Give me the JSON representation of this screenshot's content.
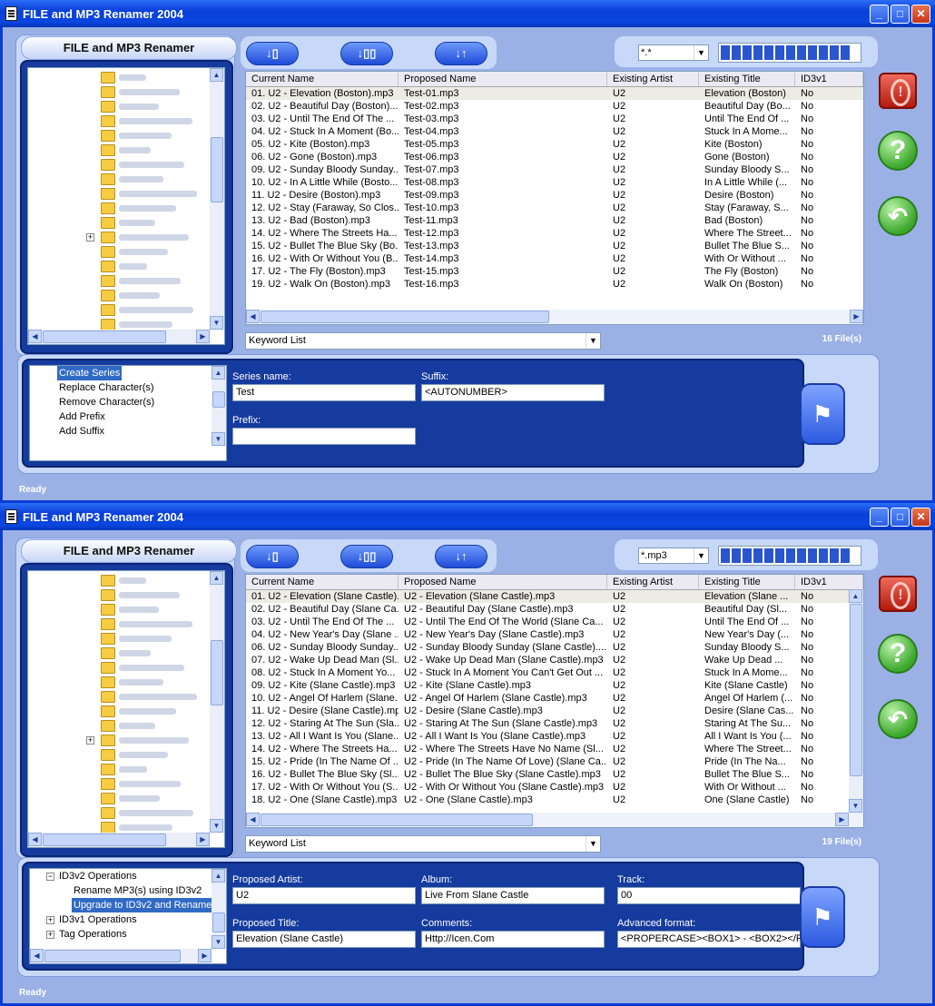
{
  "windows": [
    {
      "title": "FILE and MP3 Renamer 2004",
      "panel_title": "FILE and MP3 Renamer",
      "filter_value": "*.*",
      "files_count": "16 File(s)",
      "keyword_list": "Keyword List",
      "status": "Ready",
      "columns": [
        "Current Name",
        "Proposed Name",
        "Existing Artist",
        "Existing Title",
        "ID3v1"
      ],
      "rows": [
        [
          "01. U2 - Elevation (Boston).mp3",
          "Test-01.mp3",
          "U2",
          "Elevation (Boston)",
          "No"
        ],
        [
          "02. U2 - Beautiful Day (Boston)....",
          "Test-02.mp3",
          "U2",
          "Beautiful Day (Bo...",
          "No"
        ],
        [
          "03. U2 - Until The End Of The ...",
          "Test-03.mp3",
          "U2",
          "Until The End Of ...",
          "No"
        ],
        [
          "04. U2 - Stuck In A Moment (Bo...",
          "Test-04.mp3",
          "U2",
          "Stuck In A Mome...",
          "No"
        ],
        [
          "05. U2 - Kite (Boston).mp3",
          "Test-05.mp3",
          "U2",
          "Kite (Boston)",
          "No"
        ],
        [
          "06. U2 - Gone (Boston).mp3",
          "Test-06.mp3",
          "U2",
          "Gone (Boston)",
          "No"
        ],
        [
          "09. U2 - Sunday Bloody Sunday...",
          "Test-07.mp3",
          "U2",
          "Sunday Bloody S...",
          "No"
        ],
        [
          "10. U2 - In A Little While (Bosto...",
          "Test-08.mp3",
          "U2",
          "In A Little While (...",
          "No"
        ],
        [
          "11. U2 - Desire (Boston).mp3",
          "Test-09.mp3",
          "U2",
          "Desire (Boston)",
          "No"
        ],
        [
          "12. U2 - Stay (Faraway, So Clos...",
          "Test-10.mp3",
          "U2",
          "Stay (Faraway, S...",
          "No"
        ],
        [
          "13. U2 - Bad (Boston).mp3",
          "Test-11.mp3",
          "U2",
          "Bad (Boston)",
          "No"
        ],
        [
          "14. U2 - Where The Streets Ha...",
          "Test-12.mp3",
          "U2",
          "Where The Street...",
          "No"
        ],
        [
          "15. U2 - Bullet The Blue Sky (Bo...",
          "Test-13.mp3",
          "U2",
          "Bullet The Blue S...",
          "No"
        ],
        [
          "16. U2 - With Or Without You (B...",
          "Test-14.mp3",
          "U2",
          "With Or Without ...",
          "No"
        ],
        [
          "17. U2 - The Fly (Boston).mp3",
          "Test-15.mp3",
          "U2",
          "The Fly (Boston)",
          "No"
        ],
        [
          "19. U2 - Walk On (Boston).mp3",
          "Test-16.mp3",
          "U2",
          "Walk On (Boston)",
          "No"
        ]
      ],
      "ops_items": [
        "Create Series",
        "Replace Character(s)",
        "Remove Character(s)",
        "Add Prefix",
        "Add Suffix"
      ],
      "fields": {
        "series_name_label": "Series name:",
        "series_name_value": "Test",
        "suffix_label": "Suffix:",
        "suffix_value": "<AUTONUMBER>",
        "prefix_label": "Prefix:",
        "prefix_value": ""
      }
    },
    {
      "title": "FILE and MP3 Renamer 2004",
      "panel_title": "FILE and MP3 Renamer",
      "filter_value": "*.mp3",
      "files_count": "19 File(s)",
      "keyword_list": "Keyword List",
      "status": "Ready",
      "columns": [
        "Current Name",
        "Proposed Name",
        "Existing Artist",
        "Existing Title",
        "ID3v1"
      ],
      "rows": [
        [
          "01. U2 - Elevation (Slane Castle)...",
          "U2 - Elevation (Slane Castle).mp3",
          "U2",
          "Elevation (Slane ...",
          "No"
        ],
        [
          "02. U2 - Beautiful Day (Slane Ca...",
          "U2 - Beautiful Day (Slane Castle).mp3",
          "U2",
          "Beautiful Day (Sl...",
          "No"
        ],
        [
          "03. U2 - Until The End Of The ...",
          "U2 - Until The End Of The World (Slane Ca...",
          "U2",
          "Until The End Of ...",
          "No"
        ],
        [
          "04. U2 - New Year's Day (Slane ...",
          "U2 - New Year's Day (Slane Castle).mp3",
          "U2",
          "New Year's Day (...",
          "No"
        ],
        [
          "06. U2 - Sunday Bloody Sunday...",
          "U2 - Sunday Bloody Sunday (Slane Castle)....",
          "U2",
          "Sunday Bloody S...",
          "No"
        ],
        [
          "07. U2 - Wake Up Dead Man (Sl...",
          "U2 - Wake Up Dead Man (Slane Castle).mp3",
          "U2",
          "Wake Up Dead ...",
          "No"
        ],
        [
          "08. U2 - Stuck In A Moment Yo...",
          "U2 - Stuck In A Moment You Can't Get Out ...",
          "U2",
          "Stuck In A Mome...",
          "No"
        ],
        [
          "09. U2 - Kite (Slane Castle).mp3",
          "U2 - Kite (Slane Castle).mp3",
          "U2",
          "Kite (Slane Castle)",
          "No"
        ],
        [
          "10. U2 - Angel Of Harlem (Slane...",
          "U2 - Angel Of Harlem (Slane Castle).mp3",
          "U2",
          "Angel Of Harlem (...",
          "No"
        ],
        [
          "11. U2 - Desire (Slane Castle).mp3",
          "U2 - Desire (Slane Castle).mp3",
          "U2",
          "Desire (Slane Cas...",
          "No"
        ],
        [
          "12. U2 - Staring At The Sun (Sla...",
          "U2 - Staring At The Sun (Slane Castle).mp3",
          "U2",
          "Staring At The Su...",
          "No"
        ],
        [
          "13. U2 - All I Want Is You (Slane...",
          "U2 - All I Want Is You (Slane Castle).mp3",
          "U2",
          "All I Want Is You (...",
          "No"
        ],
        [
          "14. U2 - Where The Streets Ha...",
          "U2 - Where The Streets Have No Name (Sl...",
          "U2",
          "Where The Street...",
          "No"
        ],
        [
          "15. U2 - Pride (In The Name Of ...",
          "U2 - Pride (In The Name Of Love) (Slane Ca...",
          "U2",
          "Pride (In The Na...",
          "No"
        ],
        [
          "16. U2 - Bullet The Blue Sky (Sl...",
          "U2 - Bullet The Blue Sky (Slane Castle).mp3",
          "U2",
          "Bullet The Blue S...",
          "No"
        ],
        [
          "17. U2 - With Or Without You (S...",
          "U2 - With Or Without You (Slane Castle).mp3",
          "U2",
          "With Or Without ...",
          "No"
        ],
        [
          "18. U2 - One (Slane Castle).mp3",
          "U2 - One (Slane Castle).mp3",
          "U2",
          "One (Slane Castle)",
          "No"
        ]
      ],
      "ops_items": [
        "ID3v2 Operations",
        "Rename MP3(s) using ID3v2",
        "Upgrade to ID3v2 and Rename",
        "ID3v1 Operations",
        "Tag Operations"
      ],
      "fields": {
        "artist_label": "Proposed Artist:",
        "artist_value": "U2",
        "album_label": "Album:",
        "album_value": "Live From Slane Castle",
        "track_label": "Track:",
        "track_value": "00",
        "title_label": "Proposed Title:",
        "title_value": "Elevation (Slane Castle)",
        "comments_label": "Comments:",
        "comments_value": "Http://Icen.Com",
        "advanced_label": "Advanced format:",
        "advanced_value": "<PROPERCASE><BOX1> - <BOX2></P"
      }
    }
  ],
  "icons": {
    "minimize": "minimize-icon",
    "maximize": "maximize-icon",
    "close": "close-icon",
    "sort_down": "sort-down-icon",
    "sort_copy": "sort-copy-icon",
    "sort_up": "sort-up-icon",
    "stop": "stop-icon",
    "help": "help-icon",
    "undo": "undo-icon",
    "finish": "checkered-flag-icon",
    "folder": "folder-icon"
  }
}
